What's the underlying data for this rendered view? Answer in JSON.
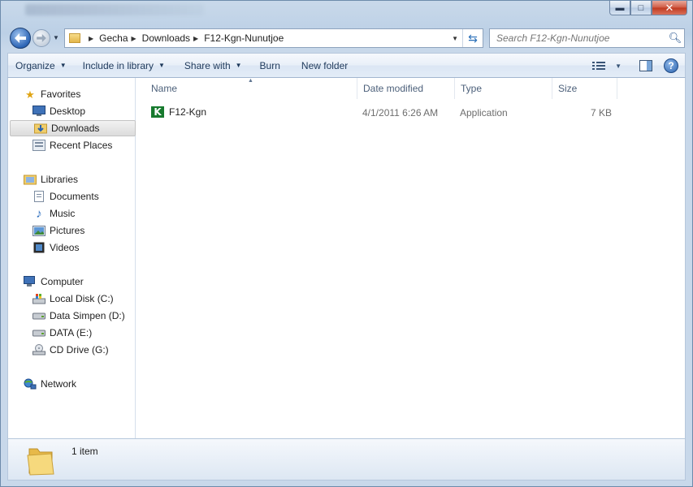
{
  "window": {
    "caption": {
      "minimize": "▬",
      "maximize": "□",
      "close": "✕"
    }
  },
  "address": {
    "crumbs": [
      "Gecha",
      "Downloads",
      "F12-Kgn-Nunutjoe"
    ]
  },
  "search": {
    "placeholder": "Search F12-Kgn-Nunutjoe"
  },
  "toolbar": {
    "organize": "Organize",
    "include_in_library": "Include in library",
    "share_with": "Share with",
    "burn": "Burn",
    "new_folder": "New folder",
    "help": "?"
  },
  "navpane": {
    "favorites": "Favorites",
    "desktop": "Desktop",
    "downloads": "Downloads",
    "recent_places": "Recent Places",
    "libraries": "Libraries",
    "documents": "Documents",
    "music": "Music",
    "pictures": "Pictures",
    "videos": "Videos",
    "computer": "Computer",
    "local_disk": "Local Disk (C:)",
    "data_simpen": "Data Simpen (D:)",
    "data_e": "DATA (E:)",
    "cd_drive": "CD Drive (G:)",
    "network": "Network"
  },
  "columns": {
    "name": "Name",
    "date_modified": "Date modified",
    "type": "Type",
    "size": "Size"
  },
  "files": [
    {
      "name": "F12-Kgn",
      "date_modified": "4/1/2011 6:26 AM",
      "type": "Application",
      "size": "7 KB",
      "icon": "kgn-app-icon"
    }
  ],
  "details": {
    "item_count": "1 item"
  },
  "colors": {
    "accent": "#1e395b",
    "selection": "#dcdcdc",
    "app_icon": "#177a2e"
  }
}
